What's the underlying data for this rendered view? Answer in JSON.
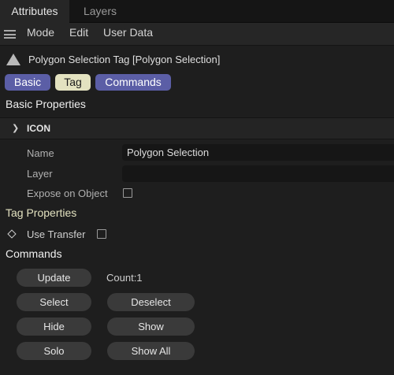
{
  "tabs": [
    {
      "label": "Attributes",
      "active": true
    },
    {
      "label": "Layers",
      "active": false
    }
  ],
  "menu": {
    "hamburger_icon": "hamburger-menu-icon",
    "items": [
      "Mode",
      "Edit",
      "User Data"
    ]
  },
  "object": {
    "icon": "triangle-polygon-icon",
    "title": "Polygon Selection Tag [Polygon Selection]"
  },
  "pills": {
    "basic": "Basic",
    "tag": "Tag",
    "commands": "Commands"
  },
  "basic_properties": {
    "title": "Basic Properties",
    "icon_group": {
      "label": "ICON",
      "icon": "chevron-right-icon"
    },
    "name_label": "Name",
    "name_value": "Polygon Selection",
    "layer_label": "Layer",
    "layer_value": "",
    "expose_label": "Expose on Object",
    "expose_checked": false
  },
  "tag_properties": {
    "title": "Tag Properties",
    "use_transfer_label": "Use Transfer",
    "use_transfer_checked": false,
    "keyframe_icon": "diamond-keyframe-icon"
  },
  "commands": {
    "title": "Commands",
    "update": "Update",
    "count": "Count:1",
    "select": "Select",
    "deselect": "Deselect",
    "hide": "Hide",
    "show": "Show",
    "solo": "Solo",
    "show_all": "Show All"
  },
  "colors": {
    "background": "#1e1e1e",
    "pill_accent": "#5b5ea6",
    "tag_accent": "#e3e2c0",
    "button": "#3a3a3a"
  }
}
